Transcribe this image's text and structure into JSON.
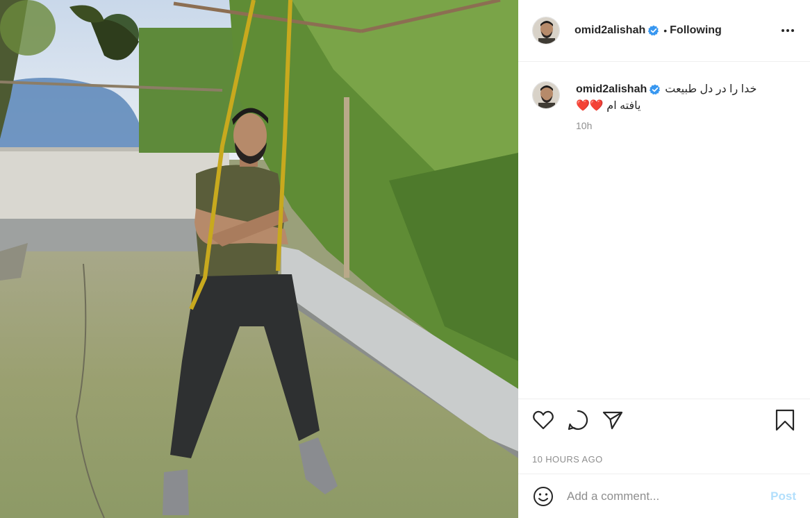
{
  "photo": {
    "alt_icon": "post-photo"
  },
  "header": {
    "username": "omid2alishah",
    "separator": "•",
    "follow_status": "Following",
    "more_icon": "more-horizontal-icon"
  },
  "caption": {
    "username": "omid2alishah",
    "text_line1": "خدا را در دل طبیعت",
    "text_line2": "یافته ام ❤️❤️",
    "time": "10h"
  },
  "actions": {
    "like_icon": "heart-icon",
    "comment_icon": "comment-icon",
    "share_icon": "share-icon",
    "save_icon": "bookmark-icon"
  },
  "timestamp": "10 HOURS AGO",
  "comment_box": {
    "emoji_icon": "emoji-icon",
    "placeholder": "Add a comment...",
    "post_label": "Post"
  },
  "colors": {
    "verified": "#3897f0",
    "post_disabled": "#b2dffc",
    "muted": "#8e8e8e",
    "text": "#262626"
  }
}
